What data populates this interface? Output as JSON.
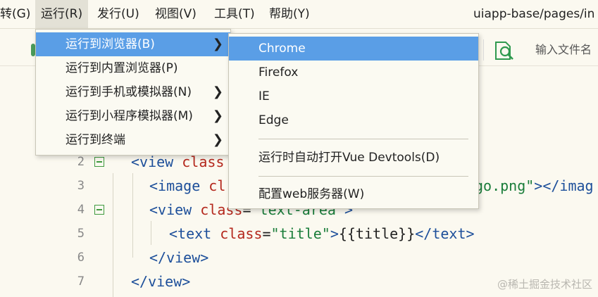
{
  "menubar": {
    "items": [
      {
        "label": "转(G)"
      },
      {
        "label": "运行(R)"
      },
      {
        "label": "发行(U)"
      },
      {
        "label": "视图(V)"
      },
      {
        "label": "工具(T)"
      },
      {
        "label": "帮助(Y)"
      }
    ],
    "path": "uiapp-base/pages/in"
  },
  "toolbar": {
    "search_placeholder": "输入文件名"
  },
  "run_menu": {
    "items": [
      {
        "label": "运行到浏览器(B)",
        "has_submenu": true
      },
      {
        "label": "运行到内置浏览器(P)",
        "has_submenu": false
      },
      {
        "label": "运行到手机或模拟器(N)",
        "has_submenu": true
      },
      {
        "label": "运行到小程序模拟器(M)",
        "has_submenu": true
      },
      {
        "label": "运行到终端",
        "has_submenu": true
      }
    ]
  },
  "browser_submenu": {
    "items": [
      {
        "label": "Chrome"
      },
      {
        "label": "Firefox"
      },
      {
        "label": "IE"
      },
      {
        "label": "Edge"
      },
      {
        "label": "运行时自动打开Vue Devtools(D)"
      },
      {
        "label": "配置web服务器(W)"
      }
    ]
  },
  "editor": {
    "lines": [
      {
        "num": "2",
        "fold": true,
        "tokens": [
          [
            "tag",
            "<view "
          ],
          [
            "attr",
            "class"
          ]
        ]
      },
      {
        "num": "3",
        "fold": false,
        "tokens": [
          [
            "tag",
            "<image "
          ],
          [
            "attr",
            "cl"
          ],
          [
            "str",
            "go.png\""
          ],
          [
            "tag",
            "></imag"
          ]
        ]
      },
      {
        "num": "4",
        "fold": true,
        "tokens": [
          [
            "tag",
            "<view "
          ],
          [
            "attr",
            "class"
          ],
          [
            "pun",
            "="
          ],
          [
            "str",
            "\"text-area\""
          ],
          [
            "tag",
            ">"
          ]
        ]
      },
      {
        "num": "5",
        "fold": false,
        "tokens": [
          [
            "tag",
            "<text "
          ],
          [
            "attr",
            "class"
          ],
          [
            "pun",
            "="
          ],
          [
            "str",
            "\"title\""
          ],
          [
            "tag",
            ">"
          ],
          [
            "pun",
            "{{title}}"
          ],
          [
            "tag",
            "</text>"
          ]
        ]
      },
      {
        "num": "6",
        "fold": false,
        "tokens": [
          [
            "tag",
            "</view>"
          ]
        ]
      },
      {
        "num": "7",
        "fold": false,
        "tokens": [
          [
            "tag",
            "</view>"
          ]
        ]
      }
    ]
  },
  "watermark": "@稀土掘金技术社区",
  "colors": {
    "highlight": "#5a9ee6",
    "tag": "#1d4f9a",
    "attr": "#b4271c",
    "string": "#1a7d3a",
    "fold": "#3f9a3f"
  }
}
